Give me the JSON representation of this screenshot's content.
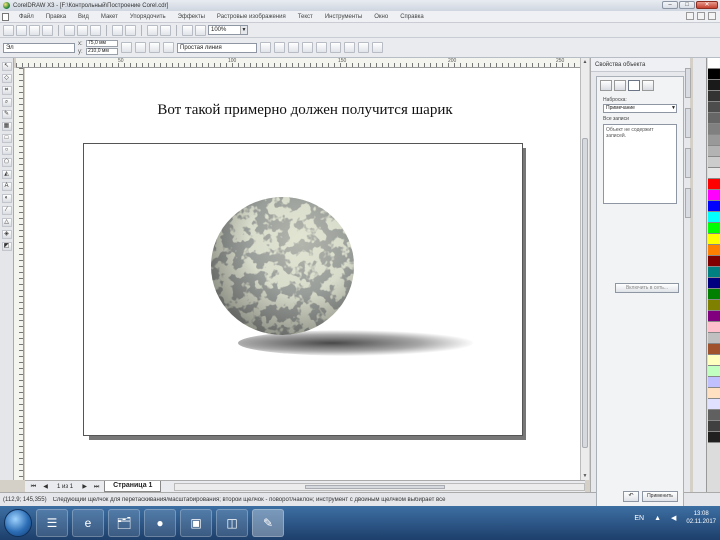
{
  "window": {
    "title": "CorelDRAW X3 - [F:\\Контрольный\\Построение Corel.cdr]",
    "minimize": "–",
    "maximize": "□",
    "close": "✕"
  },
  "menu": [
    "Файл",
    "Правка",
    "Вид",
    "Макет",
    "Упорядочить",
    "Эффекты",
    "Растровые изображения",
    "Текст",
    "Инструменты",
    "Окно",
    "Справка"
  ],
  "toolbar": {
    "zoom_value": "100%"
  },
  "propbar": {
    "object_field": "Эл",
    "x_label": "x:",
    "x_value": "75,0 мм",
    "y_label": "y:",
    "y_value": "210,0 мм",
    "outline_field": "Простая линия"
  },
  "ruler": {
    "numbers": [
      "50",
      "100",
      "150",
      "200",
      "250"
    ]
  },
  "canvas": {
    "title_text": "Вот такой примерно должен получится шарик"
  },
  "pages": {
    "counter": "1 из 1",
    "active_tab": "Страница 1"
  },
  "status": {
    "coords": "(112,9; 145,355)",
    "hint": "Следующий щелчок для перетаскивания/масштабирования; второй щелчок - поворот/наклон; инструмент с двойным щелчком выбирает все"
  },
  "docker": {
    "header": "Свойства объекта",
    "field_label": "Наброска:",
    "select_value": "Примечание",
    "notes_label": "Все записи",
    "notes_text": "Объект не содержит записей.",
    "action_button": "Включить в сеть...",
    "apply_button": "Применить",
    "apply_icon": "↶"
  },
  "palette": [
    "#ffffff",
    "#000000",
    "#1a1a1a",
    "#333333",
    "#4d4d4d",
    "#666666",
    "#808080",
    "#999999",
    "#b3b3b3",
    "#cccccc",
    "#e6e6e6",
    "#ff0000",
    "#ff00ff",
    "#0000ff",
    "#00ffff",
    "#00ff00",
    "#ffff00",
    "#ff8000",
    "#800000",
    "#008080",
    "#000080",
    "#008000",
    "#808000",
    "#800080",
    "#ffc0cb",
    "#c0c0c0",
    "#a0522d",
    "#ffffc0",
    "#c0ffc0",
    "#c0c0ff",
    "#ffe0c0",
    "#e0e0ff",
    "#606060",
    "#404040",
    "#202020"
  ],
  "taskbar": {
    "items": [
      "☰",
      "e",
      "🗂",
      "●",
      "▣",
      "◫",
      "✎"
    ],
    "lang": "EN",
    "time": "13:08",
    "date": "02.11.2017"
  }
}
